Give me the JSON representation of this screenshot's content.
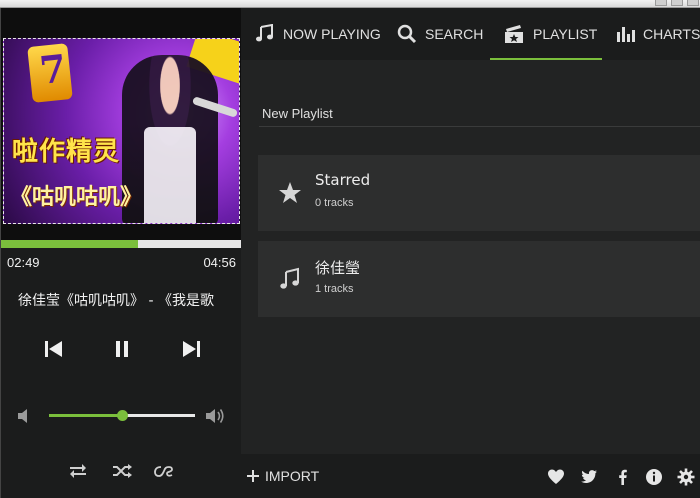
{
  "player": {
    "current_time": "02:49",
    "duration": "04:56",
    "progress": 0.57,
    "song_title": "徐佳莹《咕叽咕叽》 - 《我是歌",
    "volume": 0.5
  },
  "album_art": {
    "title_text": "啦作精灵",
    "subtitle_text": "《咕叽咕叽》"
  },
  "nav": {
    "tabs": [
      {
        "label": "NOW PLAYING",
        "icon": "music-note-icon"
      },
      {
        "label": "SEARCH",
        "icon": "search-icon"
      },
      {
        "label": "PLAYLIST",
        "icon": "playlist-icon"
      },
      {
        "label": "CHARTS",
        "icon": "chart-icon"
      }
    ],
    "active_tab": "PLAYLIST"
  },
  "playlist": {
    "new_playlist_placeholder": "New Playlist",
    "items": [
      {
        "title": "Starred",
        "subtitle": "0 tracks",
        "icon": "star-icon"
      },
      {
        "title": "徐佳瑩",
        "subtitle": "1 tracks",
        "icon": "music-note-icon"
      }
    ]
  },
  "footer": {
    "import_label": "IMPORT"
  },
  "colors": {
    "accent": "#7bbf3c",
    "background": "#222323",
    "panel": "#1b1c1c",
    "card": "#2d2e2e"
  }
}
